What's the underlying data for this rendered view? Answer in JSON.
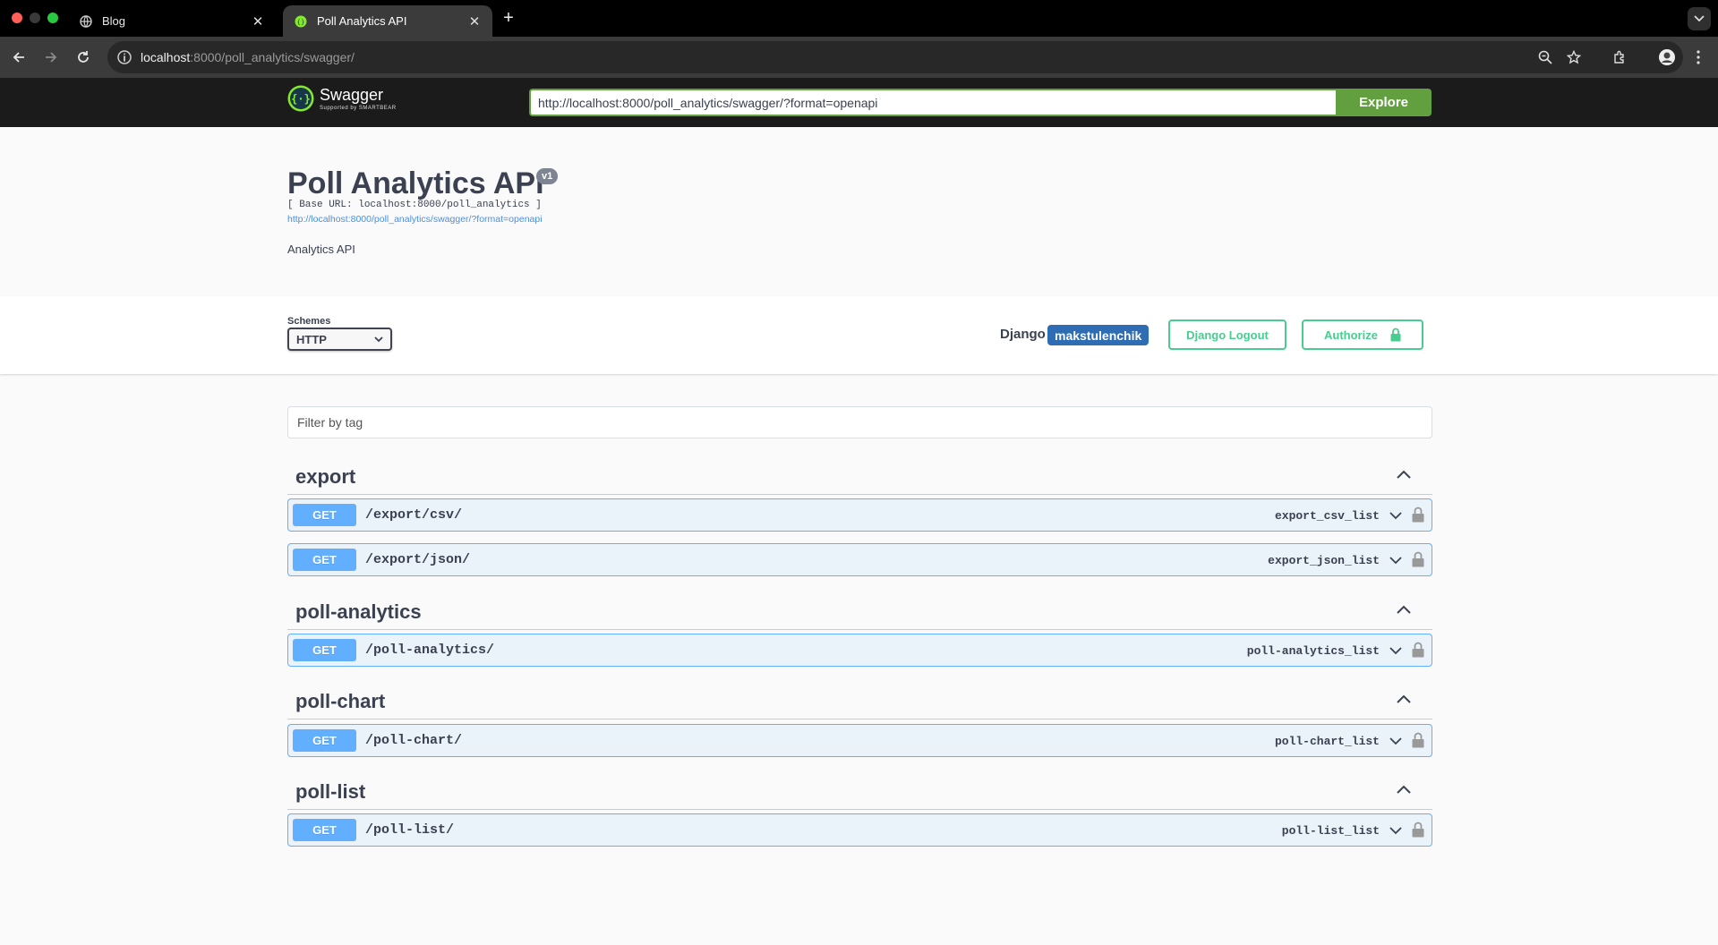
{
  "browser": {
    "tabs": [
      {
        "label": "Blog",
        "icon": "globe-icon",
        "active": false
      },
      {
        "label": "Poll Analytics API",
        "icon": "swagger-favicon-icon",
        "active": true
      }
    ],
    "url_host": "localhost",
    "url_rest": ":8000/poll_analytics/swagger/"
  },
  "swagger_topbar": {
    "brand": "Swagger",
    "brand_sub": "Supported by SMARTBEAR",
    "spec_url": "http://localhost:8000/poll_analytics/swagger/?format=openapi",
    "explore_label": "Explore"
  },
  "info": {
    "title": "Poll Analytics API",
    "version": "v1",
    "base_url": "[ Base URL: localhost:8000/poll_analytics ]",
    "spec_link": "http://localhost:8000/poll_analytics/swagger/?format=openapi",
    "description": "Analytics API"
  },
  "scheme": {
    "label": "Schemes",
    "selected": "HTTP",
    "django_label": "Django",
    "username": "makstulenchik",
    "logout_label": "Django Logout",
    "authorize_label": "Authorize"
  },
  "filter": {
    "placeholder": "Filter by tag"
  },
  "tags": [
    {
      "name": "export",
      "operations": [
        {
          "method": "GET",
          "path": "/export/csv/",
          "operation_id": "export_csv_list"
        },
        {
          "method": "GET",
          "path": "/export/json/",
          "operation_id": "export_json_list"
        }
      ]
    },
    {
      "name": "poll-analytics",
      "operations": [
        {
          "method": "GET",
          "path": "/poll-analytics/",
          "operation_id": "poll-analytics_list"
        }
      ]
    },
    {
      "name": "poll-chart",
      "operations": [
        {
          "method": "GET",
          "path": "/poll-chart/",
          "operation_id": "poll-chart_list"
        }
      ]
    },
    {
      "name": "poll-list",
      "operations": [
        {
          "method": "GET",
          "path": "/poll-list/",
          "operation_id": "poll-list_list"
        }
      ]
    }
  ],
  "colors": {
    "get_method": "#61affe",
    "authorize": "#49cc90",
    "explore": "#62a03f",
    "user_badge": "#2e6db4"
  }
}
